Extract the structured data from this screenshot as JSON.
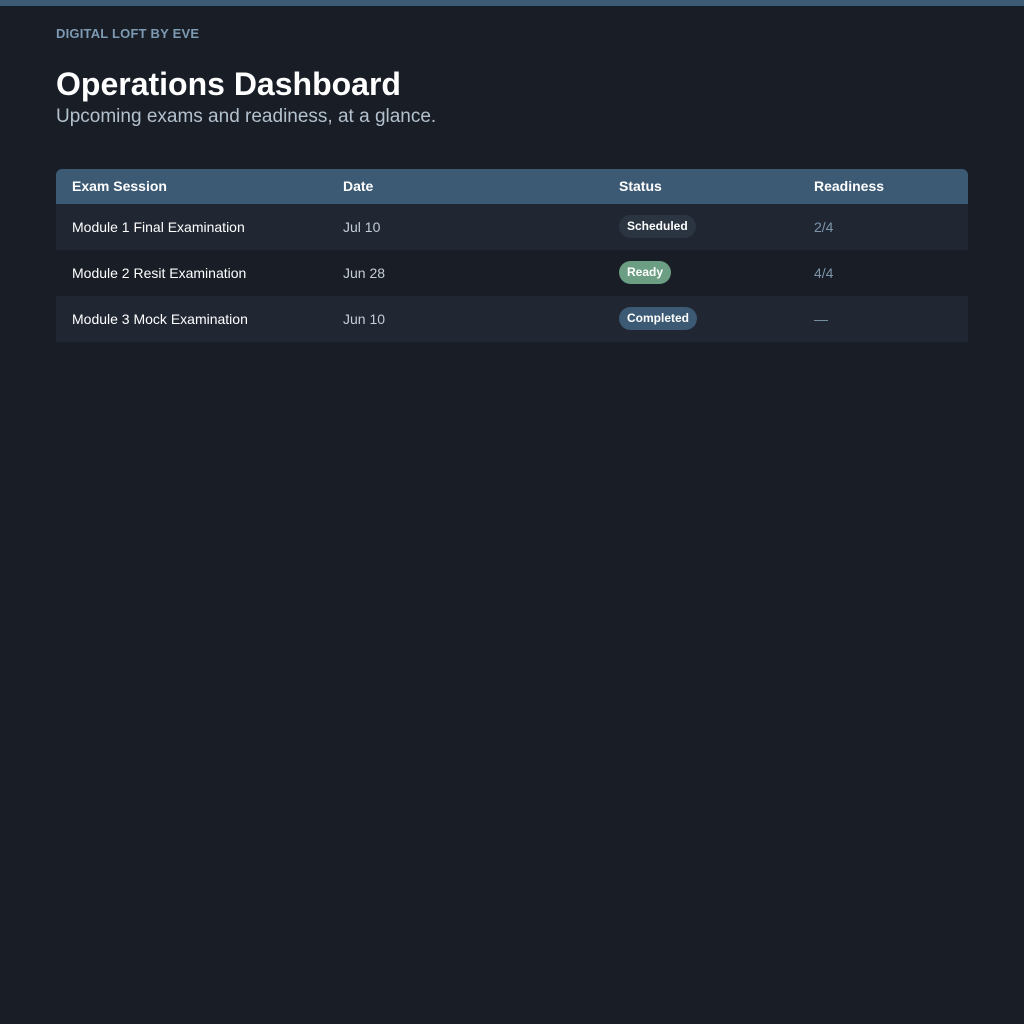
{
  "brand": "DIGITAL LOFT BY EVE",
  "header": {
    "title": "Operations Dashboard",
    "subtitle": "Upcoming exams and readiness, at a glance."
  },
  "table": {
    "columns": [
      "Exam Session",
      "Date",
      "Status",
      "Readiness"
    ],
    "rows": [
      {
        "session": "Module 1 Final Examination",
        "date": "Jul 10",
        "status": "Scheduled",
        "readiness": "2/4"
      },
      {
        "session": "Module 2 Resit Examination",
        "date": "Jun 28",
        "status": "Ready",
        "readiness": "4/4"
      },
      {
        "session": "Module 3 Mock Examination",
        "date": "Jun 10",
        "status": "Completed",
        "readiness": "—"
      }
    ]
  },
  "colors": {
    "accent": "#3d5a74",
    "background": "#181d26",
    "row_alt": "#202733",
    "status_scheduled": "#2b3441",
    "status_ready": "#6b9e83",
    "status_completed": "#3d5a74"
  }
}
